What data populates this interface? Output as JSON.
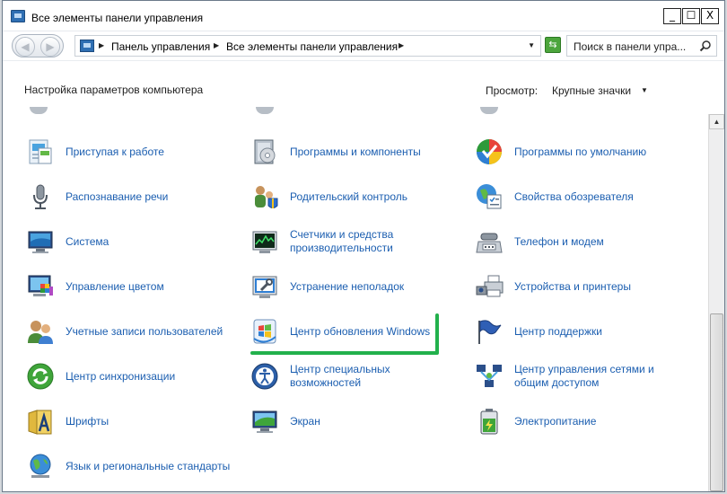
{
  "window": {
    "title": "Все элементы панели управления",
    "buttons": {
      "minimize": "_",
      "maximize": "☐",
      "close": "X"
    }
  },
  "navigation": {
    "back_icon": "back-arrow-icon",
    "forward_icon": "forward-arrow-icon",
    "breadcrumbs": [
      "Панель управления",
      "Все элементы панели управления"
    ],
    "search_placeholder": "Поиск в панели упра..."
  },
  "header": {
    "title": "Настройка параметров компьютера",
    "view_label": "Просмотр:",
    "view_value": "Крупные значки"
  },
  "items": [
    {
      "label": "Приступая к работе",
      "icon": "getting-started-icon"
    },
    {
      "label": "Программы и компоненты",
      "icon": "programs-features-icon"
    },
    {
      "label": "Программы по умолчанию",
      "icon": "default-programs-icon"
    },
    {
      "label": "Распознавание речи",
      "icon": "microphone-icon"
    },
    {
      "label": "Родительский контроль",
      "icon": "parental-controls-icon"
    },
    {
      "label": "Свойства обозревателя",
      "icon": "internet-options-icon"
    },
    {
      "label": "Система",
      "icon": "system-icon"
    },
    {
      "label": "Счетчики и средства производительности",
      "line1": "Счетчики и средства",
      "line2": "производительности",
      "icon": "performance-icon"
    },
    {
      "label": "Телефон и модем",
      "icon": "phone-modem-icon"
    },
    {
      "label": "Управление цветом",
      "icon": "color-management-icon"
    },
    {
      "label": "Устранение неполадок",
      "icon": "troubleshooting-icon"
    },
    {
      "label": "Устройства и принтеры",
      "icon": "devices-printers-icon"
    },
    {
      "label": "Учетные записи пользователей",
      "icon": "user-accounts-icon"
    },
    {
      "label": "Центр обновления Windows",
      "icon": "windows-update-icon"
    },
    {
      "label": "Центр поддержки",
      "icon": "action-center-flag-icon"
    },
    {
      "label": "Центр синхронизации",
      "icon": "sync-center-icon"
    },
    {
      "label": "Центр специальных возможностей",
      "line1": "Центр специальных",
      "line2": "возможностей",
      "icon": "ease-of-access-icon"
    },
    {
      "label": "Центр управления сетями и общим доступом",
      "line1": "Центр управления сетями и",
      "line2": "общим доступом",
      "icon": "network-center-icon"
    },
    {
      "label": "Шрифты",
      "icon": "fonts-icon"
    },
    {
      "label": "Экран",
      "icon": "display-icon"
    },
    {
      "label": "Электропитание",
      "icon": "power-options-icon"
    },
    {
      "label": "Язык и региональные стандарты",
      "icon": "region-language-icon"
    }
  ],
  "colors": {
    "link": "#1b5eb0",
    "highlight": "#22b14c"
  }
}
